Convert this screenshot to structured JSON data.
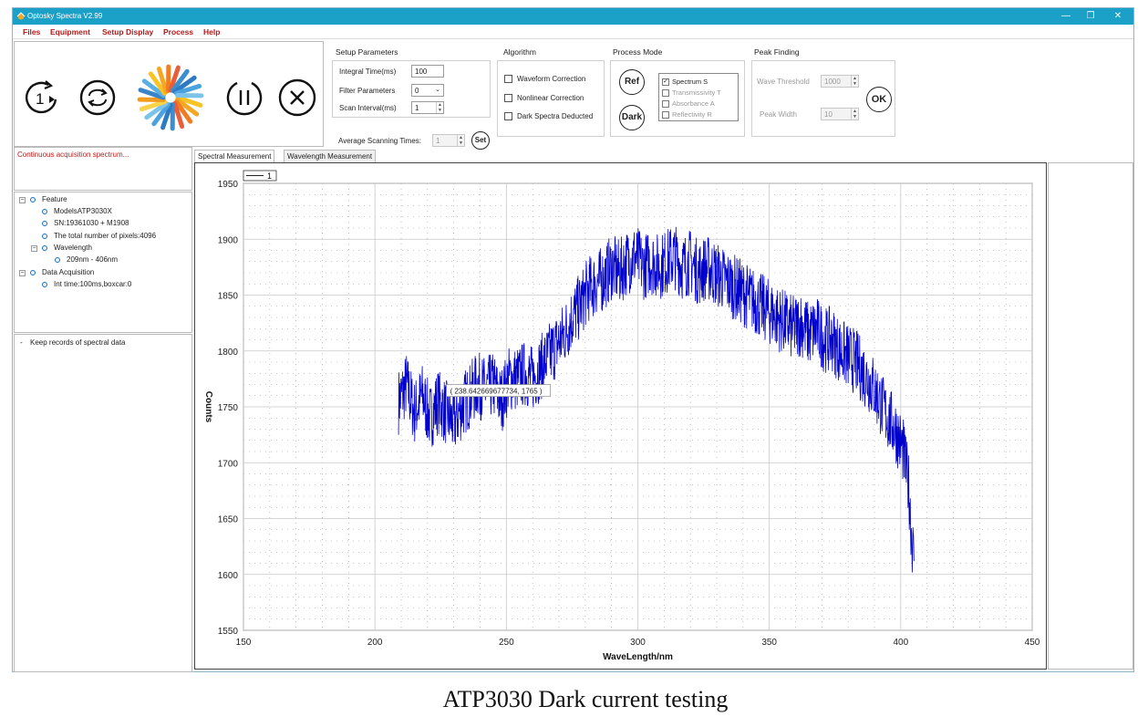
{
  "window": {
    "title": "Optosky Spectra V2.99",
    "controls": [
      "—",
      "❐",
      "✕"
    ]
  },
  "menu": [
    "Files",
    "Equipment",
    "Setup Display",
    "Process",
    "Help"
  ],
  "toolbar": {
    "buttons": [
      "single-acquisition-icon",
      "continuous-acquisition-icon",
      "logo-icon",
      "pause-icon",
      "stop-icon"
    ]
  },
  "setup": {
    "title": "Setup Parameters",
    "integral_label": "Integral Time(ms)",
    "integral_value": "100",
    "filter_label": "Filter Parameters",
    "filter_value": "0",
    "scan_label": "Scan Interval(ms)",
    "scan_value": "1",
    "avg_label": "Average Scanning Times:",
    "avg_value": "1",
    "set_label": "Set"
  },
  "algorithm": {
    "title": "Algorithm",
    "options": [
      {
        "label": "Waveform Correction",
        "checked": false
      },
      {
        "label": "Nonlinear Correction",
        "checked": false
      },
      {
        "label": "Dark Spectra Deducted",
        "checked": false
      }
    ]
  },
  "process_mode": {
    "title": "Process Mode",
    "ref_label": "Ref",
    "dark_label": "Dark",
    "modes": [
      {
        "label": "Spectrum S",
        "checked": true
      },
      {
        "label": "Transmissivity T",
        "checked": false
      },
      {
        "label": "Absorbance A",
        "checked": false
      },
      {
        "label": "Reflectivity R",
        "checked": false
      }
    ]
  },
  "peak": {
    "title": "Peak Finding",
    "threshold_label": "Wave Threshold",
    "threshold_value": "1000",
    "width_label": "Peak Width",
    "width_value": "10",
    "ok_label": "OK"
  },
  "status": {
    "text": "Continuous acquisition spectrum..."
  },
  "tree": {
    "feature": "Feature",
    "model": "ModelsATP3030X",
    "sn": "SN:19361030 + M1908",
    "pixels": "The total number of pixels:4096",
    "wavelength": "Wavelength",
    "wavelength_range": "209nm - 406nm",
    "data_acq": "Data Acquisition",
    "int_time": "Int time:100ms,boxcar:0"
  },
  "records": {
    "label": "Keep records of spectral data"
  },
  "tabs": [
    "Spectral Measurement",
    "Wavelength Measurement"
  ],
  "chart_data": {
    "type": "line",
    "xlabel": "WaveLength/nm",
    "ylabel": "Counts",
    "xlim": [
      150,
      450
    ],
    "ylim": [
      1550,
      1950
    ],
    "xticks": [
      150,
      200,
      250,
      300,
      350,
      400,
      450
    ],
    "yticks": [
      1550,
      1600,
      1650,
      1700,
      1750,
      1800,
      1850,
      1900,
      1950
    ],
    "grid": true,
    "legend": "top-left",
    "series": [
      {
        "name": "1",
        "color": "#0000cc",
        "x": [
          209,
          212,
          215,
          218,
          221,
          224,
          227,
          230,
          233,
          236,
          239,
          242,
          245,
          248,
          251,
          254,
          257,
          260,
          263,
          266,
          269,
          272,
          275,
          278,
          281,
          284,
          287,
          290,
          293,
          296,
          299,
          302,
          305,
          308,
          311,
          314,
          317,
          320,
          323,
          326,
          329,
          332,
          335,
          338,
          341,
          344,
          347,
          350,
          353,
          356,
          359,
          362,
          365,
          368,
          371,
          374,
          377,
          380,
          383,
          386,
          389,
          392,
          395,
          398,
          401,
          403,
          404,
          405
        ],
        "y": [
          1755,
          1770,
          1745,
          1760,
          1740,
          1755,
          1745,
          1735,
          1750,
          1760,
          1770,
          1765,
          1770,
          1755,
          1775,
          1775,
          1780,
          1775,
          1785,
          1795,
          1805,
          1815,
          1830,
          1840,
          1855,
          1860,
          1865,
          1875,
          1870,
          1880,
          1885,
          1875,
          1880,
          1875,
          1880,
          1885,
          1875,
          1880,
          1870,
          1875,
          1870,
          1865,
          1860,
          1855,
          1850,
          1845,
          1840,
          1835,
          1830,
          1825,
          1820,
          1825,
          1815,
          1820,
          1810,
          1810,
          1800,
          1795,
          1790,
          1780,
          1770,
          1755,
          1740,
          1730,
          1710,
          1680,
          1640,
          1612
        ]
      }
    ],
    "annotations": [
      "( 238.642669677734, 1765 )"
    ]
  },
  "caption": "ATP3030 Dark current testing"
}
